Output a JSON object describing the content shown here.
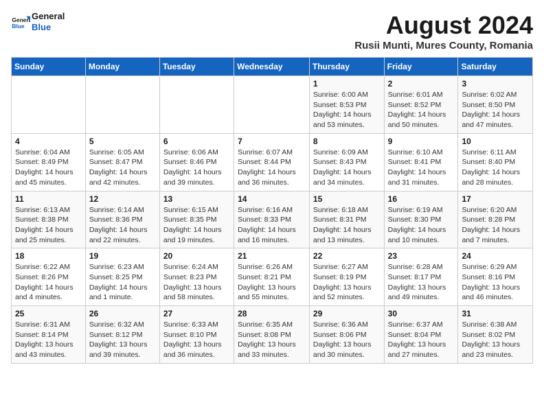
{
  "logo": {
    "general": "General",
    "blue": "Blue"
  },
  "title": "August 2024",
  "subtitle": "Rusii Munti, Mures County, Romania",
  "headers": [
    "Sunday",
    "Monday",
    "Tuesday",
    "Wednesday",
    "Thursday",
    "Friday",
    "Saturday"
  ],
  "weeks": [
    [
      {
        "day": "",
        "info": ""
      },
      {
        "day": "",
        "info": ""
      },
      {
        "day": "",
        "info": ""
      },
      {
        "day": "",
        "info": ""
      },
      {
        "day": "1",
        "info": "Sunrise: 6:00 AM\nSunset: 8:53 PM\nDaylight: 14 hours and 53 minutes."
      },
      {
        "day": "2",
        "info": "Sunrise: 6:01 AM\nSunset: 8:52 PM\nDaylight: 14 hours and 50 minutes."
      },
      {
        "day": "3",
        "info": "Sunrise: 6:02 AM\nSunset: 8:50 PM\nDaylight: 14 hours and 47 minutes."
      }
    ],
    [
      {
        "day": "4",
        "info": "Sunrise: 6:04 AM\nSunset: 8:49 PM\nDaylight: 14 hours and 45 minutes."
      },
      {
        "day": "5",
        "info": "Sunrise: 6:05 AM\nSunset: 8:47 PM\nDaylight: 14 hours and 42 minutes."
      },
      {
        "day": "6",
        "info": "Sunrise: 6:06 AM\nSunset: 8:46 PM\nDaylight: 14 hours and 39 minutes."
      },
      {
        "day": "7",
        "info": "Sunrise: 6:07 AM\nSunset: 8:44 PM\nDaylight: 14 hours and 36 minutes."
      },
      {
        "day": "8",
        "info": "Sunrise: 6:09 AM\nSunset: 8:43 PM\nDaylight: 14 hours and 34 minutes."
      },
      {
        "day": "9",
        "info": "Sunrise: 6:10 AM\nSunset: 8:41 PM\nDaylight: 14 hours and 31 minutes."
      },
      {
        "day": "10",
        "info": "Sunrise: 6:11 AM\nSunset: 8:40 PM\nDaylight: 14 hours and 28 minutes."
      }
    ],
    [
      {
        "day": "11",
        "info": "Sunrise: 6:13 AM\nSunset: 8:38 PM\nDaylight: 14 hours and 25 minutes."
      },
      {
        "day": "12",
        "info": "Sunrise: 6:14 AM\nSunset: 8:36 PM\nDaylight: 14 hours and 22 minutes."
      },
      {
        "day": "13",
        "info": "Sunrise: 6:15 AM\nSunset: 8:35 PM\nDaylight: 14 hours and 19 minutes."
      },
      {
        "day": "14",
        "info": "Sunrise: 6:16 AM\nSunset: 8:33 PM\nDaylight: 14 hours and 16 minutes."
      },
      {
        "day": "15",
        "info": "Sunrise: 6:18 AM\nSunset: 8:31 PM\nDaylight: 14 hours and 13 minutes."
      },
      {
        "day": "16",
        "info": "Sunrise: 6:19 AM\nSunset: 8:30 PM\nDaylight: 14 hours and 10 minutes."
      },
      {
        "day": "17",
        "info": "Sunrise: 6:20 AM\nSunset: 8:28 PM\nDaylight: 14 hours and 7 minutes."
      }
    ],
    [
      {
        "day": "18",
        "info": "Sunrise: 6:22 AM\nSunset: 8:26 PM\nDaylight: 14 hours and 4 minutes."
      },
      {
        "day": "19",
        "info": "Sunrise: 6:23 AM\nSunset: 8:25 PM\nDaylight: 14 hours and 1 minute."
      },
      {
        "day": "20",
        "info": "Sunrise: 6:24 AM\nSunset: 8:23 PM\nDaylight: 13 hours and 58 minutes."
      },
      {
        "day": "21",
        "info": "Sunrise: 6:26 AM\nSunset: 8:21 PM\nDaylight: 13 hours and 55 minutes."
      },
      {
        "day": "22",
        "info": "Sunrise: 6:27 AM\nSunset: 8:19 PM\nDaylight: 13 hours and 52 minutes."
      },
      {
        "day": "23",
        "info": "Sunrise: 6:28 AM\nSunset: 8:17 PM\nDaylight: 13 hours and 49 minutes."
      },
      {
        "day": "24",
        "info": "Sunrise: 6:29 AM\nSunset: 8:16 PM\nDaylight: 13 hours and 46 minutes."
      }
    ],
    [
      {
        "day": "25",
        "info": "Sunrise: 6:31 AM\nSunset: 8:14 PM\nDaylight: 13 hours and 43 minutes."
      },
      {
        "day": "26",
        "info": "Sunrise: 6:32 AM\nSunset: 8:12 PM\nDaylight: 13 hours and 39 minutes."
      },
      {
        "day": "27",
        "info": "Sunrise: 6:33 AM\nSunset: 8:10 PM\nDaylight: 13 hours and 36 minutes."
      },
      {
        "day": "28",
        "info": "Sunrise: 6:35 AM\nSunset: 8:08 PM\nDaylight: 13 hours and 33 minutes."
      },
      {
        "day": "29",
        "info": "Sunrise: 6:36 AM\nSunset: 8:06 PM\nDaylight: 13 hours and 30 minutes."
      },
      {
        "day": "30",
        "info": "Sunrise: 6:37 AM\nSunset: 8:04 PM\nDaylight: 13 hours and 27 minutes."
      },
      {
        "day": "31",
        "info": "Sunrise: 6:38 AM\nSunset: 8:02 PM\nDaylight: 13 hours and 23 minutes."
      }
    ]
  ],
  "colors": {
    "header_bg": "#1565c0",
    "header_text": "#ffffff"
  }
}
